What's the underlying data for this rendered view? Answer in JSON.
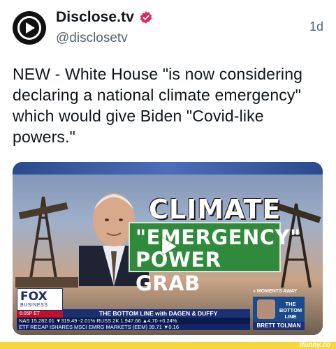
{
  "account": {
    "display_name": "Disclose.tv",
    "handle": "@disclosetv",
    "timestamp": "1d",
    "verified_icon": "verified-badge-icon",
    "avatar_icon": "play-circle-logo-icon"
  },
  "tweet": {
    "text": "NEW - White House \"is now considering declaring a national climate emergency\" which would give Biden \"Covid-like powers.\""
  },
  "media": {
    "type": "video",
    "headline_line1": "CLIMATE",
    "headline_line2": "\"EMERGENCY\"",
    "headline_line3": "POWER GRAB",
    "network": "FOX",
    "network_sub": "BUSINESS",
    "clock": "6:05P ET",
    "show_bar": "THE BOTTOM LINE with DAGEN & DUFFY",
    "ticker_line1": "NAS 15,282.01 ▼319.49 -2.01% RUSS 2K 1,947.66 ▲4.70 +0.24%",
    "ticker_line2": "ETF RECAP ISHARES MSCI EMRG MARKETS (EEM) 39.71 ▼0.16",
    "moments_away": "» MOMENTS AWAY",
    "show_logo": "THE BOTTOM LINE",
    "guest_name": "BRETT TOLMAN",
    "play_icon": "play-icon"
  },
  "watermark": {
    "text": "ifunny.co"
  },
  "colors": {
    "text_primary": "#0f1419",
    "text_secondary": "#536471",
    "verified": "#e0245e",
    "green_graphic": "#2f8a3c",
    "fox_blue": "#1b2f73",
    "watermark_yellow": "#f7d83a"
  }
}
